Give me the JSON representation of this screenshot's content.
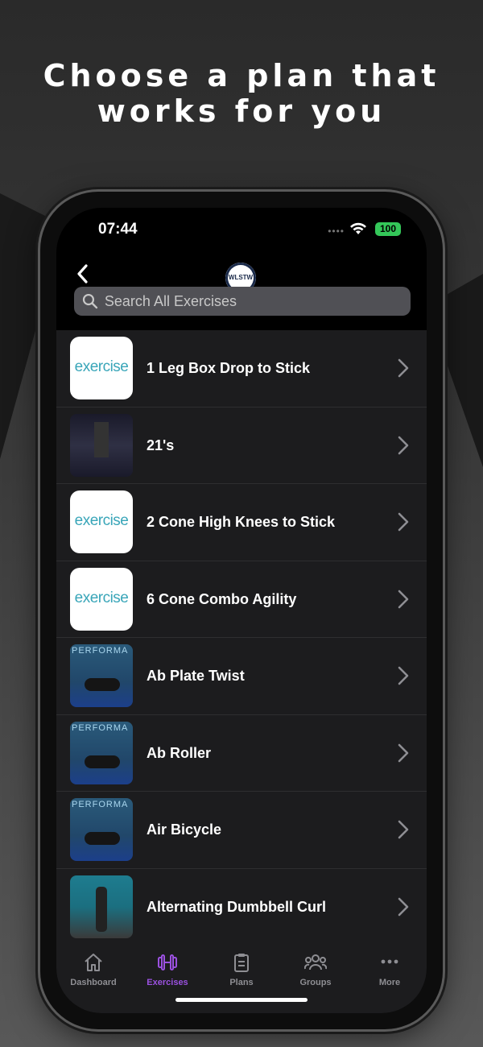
{
  "headline": {
    "line1": "Choose a plan that",
    "line2": "works for you"
  },
  "status_bar": {
    "time": "07:44",
    "battery": "100"
  },
  "nav": {
    "logo_text": "WLSTW"
  },
  "search": {
    "placeholder": "Search All Exercises"
  },
  "exercises": [
    {
      "name": "1 Leg Box Drop to Stick",
      "thumb": "exercise",
      "thumb_text": "exercise"
    },
    {
      "name": "21's",
      "thumb": "dark"
    },
    {
      "name": "2 Cone High Knees to Stick",
      "thumb": "exercise",
      "thumb_text": "exercise"
    },
    {
      "name": "6 Cone Combo Agility",
      "thumb": "exercise",
      "thumb_text": "exercise"
    },
    {
      "name": "Ab Plate Twist",
      "thumb": "photo",
      "thumb_text": "PERFORMA"
    },
    {
      "name": "Ab Roller",
      "thumb": "photo",
      "thumb_text": "PERFORMA"
    },
    {
      "name": "Air Bicycle",
      "thumb": "photo",
      "thumb_text": "PERFORMA"
    },
    {
      "name": "Alternating Dumbbell Curl",
      "thumb": "gym"
    }
  ],
  "tabs": [
    {
      "label": "Dashboard",
      "icon": "home-icon"
    },
    {
      "label": "Exercises",
      "icon": "dumbbell-icon",
      "active": true
    },
    {
      "label": "Plans",
      "icon": "clipboard-icon"
    },
    {
      "label": "Groups",
      "icon": "group-icon"
    },
    {
      "label": "More",
      "icon": "more-icon"
    }
  ],
  "colors": {
    "accent": "#9b51e0",
    "battery": "#34c759",
    "list_bg": "#1c1c1e"
  }
}
